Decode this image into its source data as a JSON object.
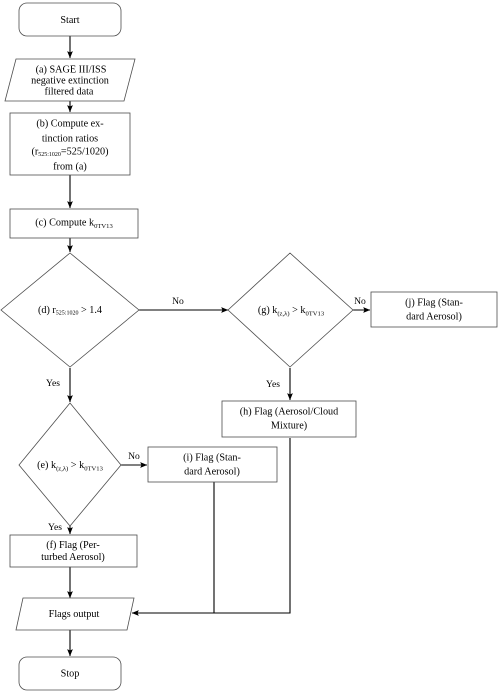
{
  "diagram": {
    "title": "SAGE III/ISS aerosol/cloud classification flowchart",
    "colors": {
      "node_stroke": "#4d4d4d",
      "edge_stroke": "#000000",
      "node_fill": "#ffffff",
      "background": "#ffffff",
      "text": "#000000"
    },
    "nodes": [
      {
        "id": "start",
        "label": "Start",
        "shape": "rounded-rectangle",
        "lines": [
          "Start"
        ]
      },
      {
        "id": "a",
        "label": "(a) SAGE III/ISS negative extinction filtered data",
        "shape": "parallelogram",
        "lines": [
          "(a) SAGE III/ISS",
          "negative extinction",
          "filtered data"
        ]
      },
      {
        "id": "b",
        "label": "(b) Compute extinction ratios (r525:1020=525/1020) from (a)",
        "shape": "rectangle",
        "lines": [
          "(b) Compute ex-",
          "tinction ratios",
          "(r525:1020=525/1020)",
          "from (a)"
        ],
        "line3_parts": {
          "pre": "(r",
          "sub": "525:1020",
          "post": "=525/1020)"
        }
      },
      {
        "id": "c",
        "label": "(c) Compute k0TV13",
        "shape": "rectangle",
        "lines": [
          "(c) Compute k0TV13"
        ],
        "parts": {
          "pre": "(c) Compute k",
          "sub": "0TV13",
          "post": ""
        }
      },
      {
        "id": "d",
        "label": "(d) r525:1020 > 1.4",
        "shape": "diamond",
        "parts": {
          "pre": "(d) r",
          "sub": "525:1020",
          "post": " > 1.4"
        }
      },
      {
        "id": "e",
        "label": "(e) k(z,λ) > k0TV13",
        "shape": "diamond",
        "parts": {
          "pre": "(e) k",
          "sub": "(z,λ)",
          "mid": " > k",
          "sub2": "0TV13"
        }
      },
      {
        "id": "f",
        "label": "(f) Flag (Perturbed Aerosol)",
        "shape": "rectangle",
        "lines": [
          "(f) Flag (Per-",
          "turbed Aerosol)"
        ]
      },
      {
        "id": "g",
        "label": "(g) k(z,λ) > k0TV13",
        "shape": "diamond",
        "parts": {
          "pre": "(g) k",
          "sub": "(z,λ)",
          "mid": " > k",
          "sub2": "0TV13"
        }
      },
      {
        "id": "h",
        "label": "(h) Flag (Aerosol/Cloud Mixture)",
        "shape": "rectangle",
        "lines": [
          "(h) Flag (Aerosol/Cloud",
          "Mixture)"
        ]
      },
      {
        "id": "i",
        "label": "(i) Flag (Standard Aerosol)",
        "shape": "rectangle",
        "lines": [
          "(i) Flag (Stan-",
          "dard Aerosol)"
        ]
      },
      {
        "id": "j",
        "label": "(j) Flag (Standard Aerosol)",
        "shape": "rectangle",
        "lines": [
          "(j) Flag (Stan-",
          "dard Aerosol)"
        ]
      },
      {
        "id": "flags_output",
        "label": "Flags output",
        "shape": "parallelogram",
        "lines": [
          "Flags output"
        ]
      },
      {
        "id": "stop",
        "label": "Stop",
        "shape": "rounded-rectangle",
        "lines": [
          "Stop"
        ]
      }
    ],
    "edges": [
      {
        "id": "start-a",
        "from": "start",
        "to": "a",
        "label": ""
      },
      {
        "id": "a-b",
        "from": "a",
        "to": "b",
        "label": ""
      },
      {
        "id": "b-c",
        "from": "b",
        "to": "c",
        "label": ""
      },
      {
        "id": "c-d",
        "from": "c",
        "to": "d",
        "label": ""
      },
      {
        "id": "d-g",
        "from": "d",
        "to": "g",
        "label": "No"
      },
      {
        "id": "d-e",
        "from": "d",
        "to": "e",
        "label": "Yes"
      },
      {
        "id": "g-j",
        "from": "g",
        "to": "j",
        "label": "No"
      },
      {
        "id": "g-h",
        "from": "g",
        "to": "h",
        "label": "Yes"
      },
      {
        "id": "e-i",
        "from": "e",
        "to": "i",
        "label": "No"
      },
      {
        "id": "e-f",
        "from": "e",
        "to": "f",
        "label": "Yes"
      },
      {
        "id": "f-flags",
        "from": "f",
        "to": "flags_output",
        "label": ""
      },
      {
        "id": "i-flags",
        "from": "i",
        "to": "flags_output",
        "label": ""
      },
      {
        "id": "h-flags",
        "from": "h",
        "to": "flags_output",
        "label": ""
      },
      {
        "id": "flags-stop",
        "from": "flags_output",
        "to": "stop",
        "label": ""
      }
    ],
    "edge_labels": {
      "d_no": "No",
      "d_yes": "Yes",
      "g_no": "No",
      "g_yes": "Yes",
      "e_no": "No",
      "e_yes": "Yes"
    }
  }
}
